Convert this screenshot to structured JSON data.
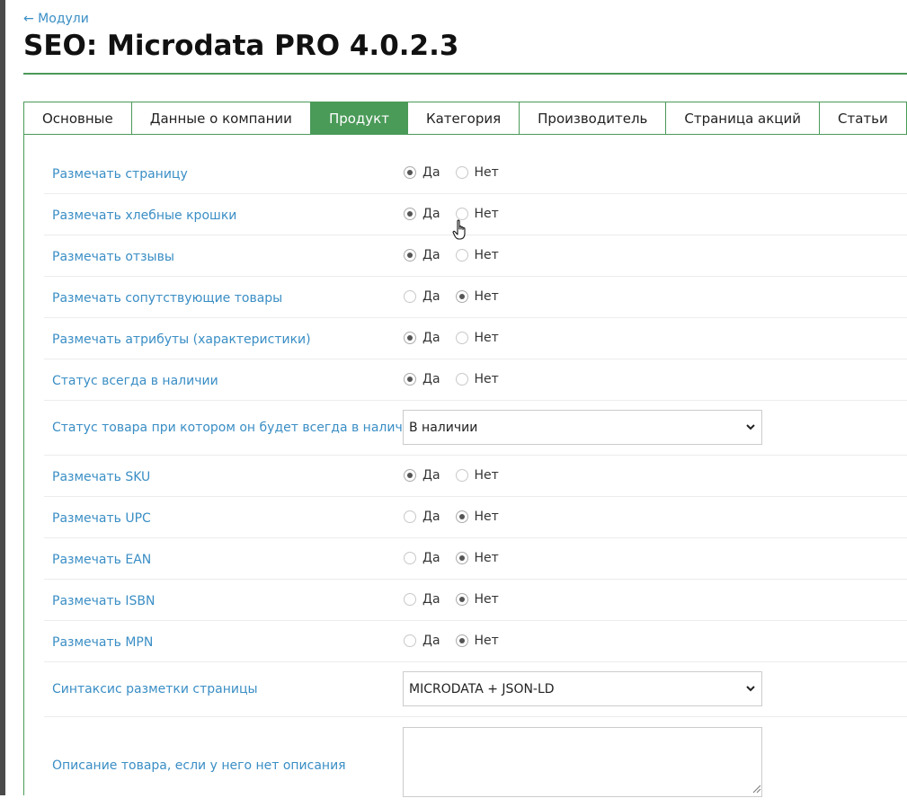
{
  "nav": {
    "back_label": "← Модули"
  },
  "header": {
    "title": "SEO: Microdata PRO 4.0.2.3"
  },
  "tabs": [
    {
      "label": "Основные",
      "active": false
    },
    {
      "label": "Данные о компании",
      "active": false
    },
    {
      "label": "Продукт",
      "active": true
    },
    {
      "label": "Категория",
      "active": false
    },
    {
      "label": "Производитель",
      "active": false
    },
    {
      "label": "Страница акций",
      "active": false
    },
    {
      "label": "Статьи",
      "active": false
    }
  ],
  "options": {
    "yes": "Да",
    "no": "Нет"
  },
  "settings": {
    "mark_page": {
      "label": "Размечать страницу",
      "value": "yes"
    },
    "mark_breadcrumbs": {
      "label": "Размечать хлебные крошки",
      "value": "yes"
    },
    "mark_reviews": {
      "label": "Размечать отзывы",
      "value": "yes"
    },
    "mark_related": {
      "label": "Размечать сопутствующие товары",
      "value": "no"
    },
    "mark_attributes": {
      "label": "Размечать атрибуты (характеристики)",
      "value": "yes"
    },
    "status_always_in_stock": {
      "label": "Статус всегда в наличии",
      "value": "yes"
    },
    "stock_status": {
      "label": "Статус товара при котором он будет всегда в наличии",
      "value": "В наличии"
    },
    "mark_sku": {
      "label": "Размечать SKU",
      "value": "yes"
    },
    "mark_upc": {
      "label": "Размечать UPC",
      "value": "no"
    },
    "mark_ean": {
      "label": "Размечать EAN",
      "value": "no"
    },
    "mark_isbn": {
      "label": "Размечать ISBN",
      "value": "no"
    },
    "mark_mpn": {
      "label": "Размечать MPN",
      "value": "no"
    },
    "markup_syntax": {
      "label": "Синтаксис разметки страницы",
      "value": "MICRODATA + JSON-LD"
    },
    "fallback_description": {
      "label": "Описание товара, если у него нет описания",
      "value": ""
    }
  },
  "colors": {
    "accent": "#4a9a58",
    "link": "#3a8ec5"
  }
}
